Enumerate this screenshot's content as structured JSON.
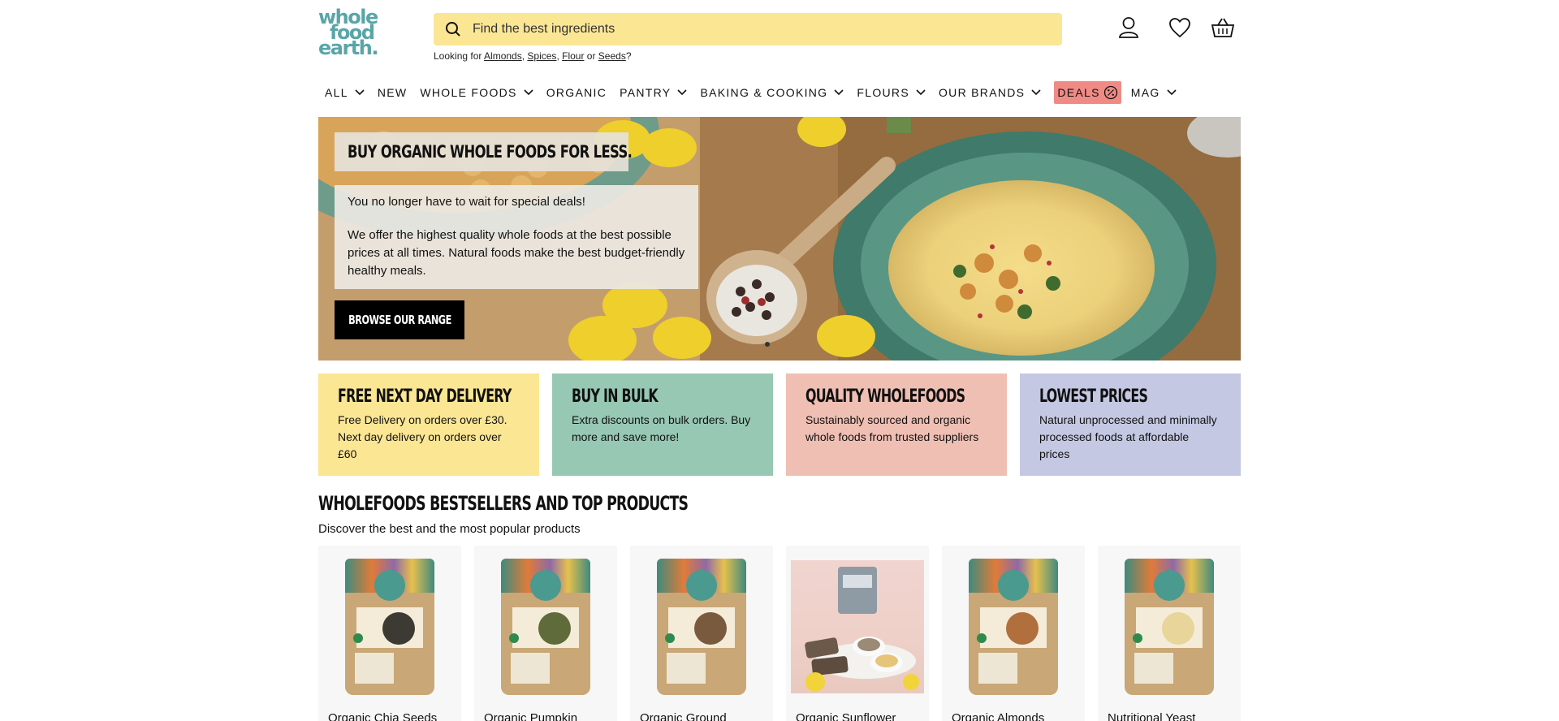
{
  "header": {
    "logo": [
      "whole",
      "food",
      "earth."
    ],
    "search": {
      "placeholder": "Find the best ingredients"
    },
    "hint": {
      "prefix": "Looking for ",
      "links": [
        "Almonds",
        "Spices",
        "Flour",
        "Seeds"
      ],
      "sep1": ", ",
      "sep2": ", ",
      "sep3": " or ",
      "suffix": "?"
    },
    "icons": [
      "account-icon",
      "wishlist-heart-icon",
      "basket-icon"
    ]
  },
  "nav": {
    "items": [
      {
        "label": "ALL",
        "has_dropdown": true
      },
      {
        "label": "NEW",
        "has_dropdown": false
      },
      {
        "label": "WHOLE FOODS",
        "has_dropdown": true
      },
      {
        "label": "ORGANIC",
        "has_dropdown": false
      },
      {
        "label": "PANTRY",
        "has_dropdown": true
      },
      {
        "label": "BAKING & COOKING",
        "has_dropdown": true
      },
      {
        "label": "FLOURS",
        "has_dropdown": true
      },
      {
        "label": "OUR BRANDS",
        "has_dropdown": true
      },
      {
        "label": "DEALS",
        "has_dropdown": false,
        "highlight": "#f08a84"
      },
      {
        "label": "MAG",
        "has_dropdown": true
      }
    ]
  },
  "hero": {
    "title": "BUY ORGANIC WHOLE FOODS FOR LESS.",
    "paragraphs": [
      "You no longer have to wait for special deals!",
      "We offer the highest quality whole foods at the best possible prices at all times. Natural foods make the best budget-friendly healthy meals."
    ],
    "button": "BROWSE OUR RANGE"
  },
  "tiles": [
    {
      "title": "FREE NEXT DAY DELIVERY",
      "text": "Free Delivery on orders over £30. Next day delivery on orders over £60",
      "color": "#fbe694"
    },
    {
      "title": "BUY IN BULK",
      "text": "Extra discounts on bulk orders. Buy more and save more!",
      "color": "#97c8b3"
    },
    {
      "title": "QUALITY WHOLEFOODS",
      "text": "Sustainably sourced and organic whole foods from trusted suppliers",
      "color": "#f0bfb3"
    },
    {
      "title": "LOWEST PRICES",
      "text": "Natural unprocessed and minimally processed foods at affordable prices",
      "color": "#c4c8e2"
    }
  ],
  "bestsellers": {
    "title": "WHOLEFOODS BESTSELLERS AND TOP PRODUCTS",
    "subtitle": "Discover the best and the most popular products",
    "products": [
      {
        "name": "Organic Chia Seeds",
        "seed_color": "#3d3a33"
      },
      {
        "name": "Organic Pumpkin",
        "seed_color": "#5f6b3a"
      },
      {
        "name": "Organic Ground",
        "seed_color": "#7a5a3e"
      },
      {
        "name": "Organic Sunflower",
        "seed_color": "#8a7b63"
      },
      {
        "name": "Organic Almonds",
        "seed_color": "#b06f3c"
      },
      {
        "name": "Nutritional Yeast",
        "seed_color": "#e8d59a"
      }
    ]
  }
}
